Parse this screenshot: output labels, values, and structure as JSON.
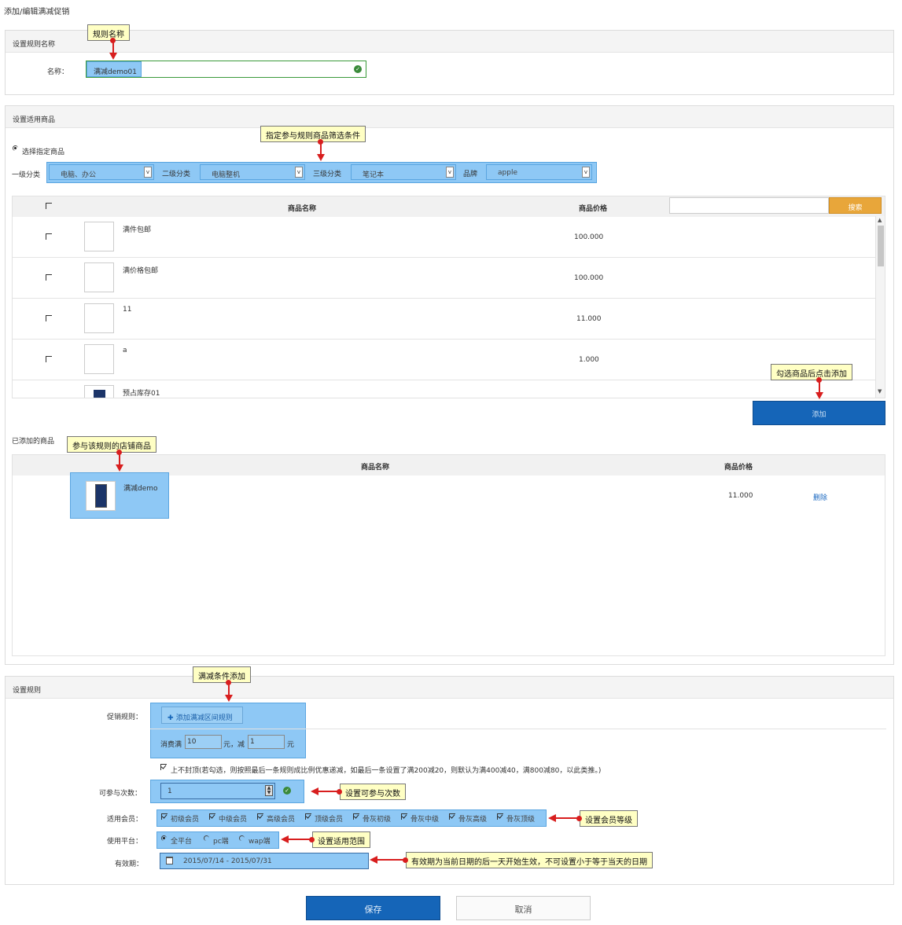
{
  "page_title": "添加/编辑满减促销",
  "rule_name_section": {
    "header": "设置规则名称",
    "name_label": "名称：",
    "name_value": "满减demo01"
  },
  "goods_section": {
    "header": "设置适用商品",
    "select_label": "选择指定商品",
    "filters": [
      {
        "label": "一级分类",
        "value": "电脑、办公"
      },
      {
        "label": "二级分类",
        "value": "电脑整机"
      },
      {
        "label": "三级分类",
        "value": "笔记本"
      },
      {
        "label": "品牌",
        "value": "apple"
      }
    ],
    "table_headers": {
      "name": "商品名称",
      "price": "商品价格"
    },
    "search_button": "搜索",
    "search_placeholder": "",
    "rows": [
      {
        "name": "满件包邮",
        "price": "100.000"
      },
      {
        "name": "满价格包邮",
        "price": "100.000"
      },
      {
        "name": "11",
        "price": "11.000"
      },
      {
        "name": "a",
        "price": "1.000"
      },
      {
        "name": "预占库存01",
        "price": ""
      }
    ],
    "add_button": "添加"
  },
  "added_section": {
    "label": "已添加的商品",
    "headers": {
      "name": "商品名称",
      "price": "商品价格"
    },
    "rows": [
      {
        "name": "满减demo",
        "price": "11.000",
        "action": "删除"
      }
    ]
  },
  "rules_section": {
    "header": "设置规则",
    "promo_label": "促销规则：",
    "add_range_button": "添加满减区间规则",
    "spend_prefix": "消费满",
    "spend_value": "10",
    "spend_mid": "元，减",
    "reduce_value": "1",
    "spend_suffix": "元",
    "no_cap_text": "上不封顶(若勾选，则按照最后一条规则成比例优惠递减，如最后一条设置了满200减20，则默认为满400减40，满800减80，以此类推。)",
    "times_label": "可参与次数：",
    "times_value": "1",
    "member_label": "适用会员：",
    "members": [
      "初级会员",
      "中级会员",
      "高级会员",
      "顶级会员",
      "骨灰初级",
      "骨灰中级",
      "骨灰高级",
      "骨灰顶级"
    ],
    "platform_label": "使用平台：",
    "platforms": [
      "全平台",
      "pc端",
      "wap端"
    ],
    "validity_label": "有效期：",
    "validity_value": "2015/07/14 - 2015/07/31"
  },
  "buttons": {
    "save": "保存",
    "cancel": "取消"
  },
  "annotations": {
    "rule_name": "规则名称",
    "filter": "指定参与规则商品筛选条件",
    "add_after_check": "勾选商品后点击添加",
    "store_goods": "参与该规则的店铺商品",
    "full_reduce_add": "满减条件添加",
    "times": "设置可参与次数",
    "member": "设置会员等级",
    "scope": "设置适用范围",
    "validity": "有效期为当前日期的后一天开始生效，不可设置小于等于当天的日期"
  },
  "colors": {
    "accent_blue": "#1565b8",
    "highlight": "#8ec8f5",
    "search_orange": "#e8a63a",
    "annotation_bg": "#ffffc4",
    "arrow_red": "#d81e1e"
  }
}
